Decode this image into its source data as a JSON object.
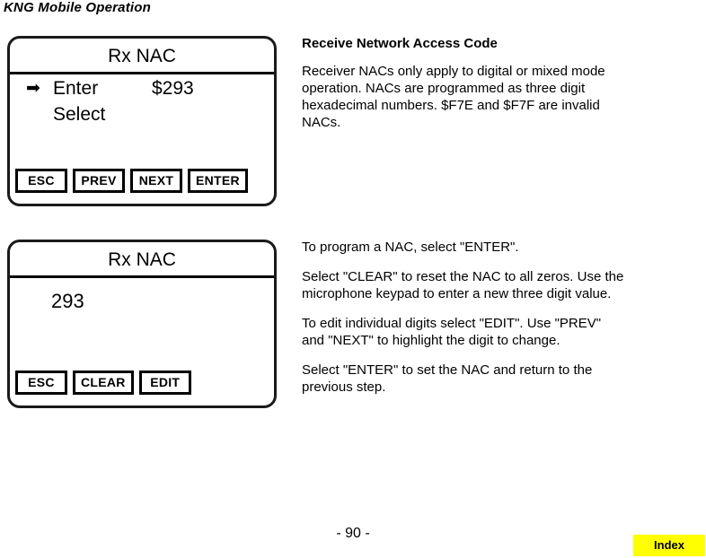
{
  "header": {
    "title": "KNG Mobile Operation"
  },
  "panels": [
    {
      "id": "lcd-1",
      "title": "Rx NAC",
      "cursor_icon": "right-arrow-icon",
      "cursor_glyph": "➡",
      "rows": [
        {
          "label": "Enter",
          "value": "$293"
        },
        {
          "label": "Select",
          "value": ""
        }
      ],
      "softkeys": [
        "ESC",
        "PREV",
        "NEXT",
        "ENTER"
      ]
    },
    {
      "id": "lcd-2",
      "title": "Rx NAC",
      "value": "293",
      "softkeys": [
        "ESC",
        "CLEAR",
        "EDIT"
      ]
    }
  ],
  "content": {
    "heading": "Receive Network Access Code",
    "intro_paragraph": "Receiver NACs only apply to digital or mixed mode operation. NACs are programmed as three digit hexadecimal numbers. $F7E and $F7F are invalid NACs.",
    "paragraphs": [
      "To program a NAC, select \"ENTER\".",
      "Select \"CLEAR\" to reset the NAC to all zeros. Use the microphone keypad to enter a new three digit value.",
      "To edit individual digits select \"EDIT\". Use \"PREV\" and \"NEXT\" to highlight the digit to change.",
      "Select \"ENTER\" to set the NAC and return to the previous step."
    ]
  },
  "footer": {
    "page_number": "- 90 -",
    "index_label": "Index",
    "index_color": "#ffff00"
  }
}
